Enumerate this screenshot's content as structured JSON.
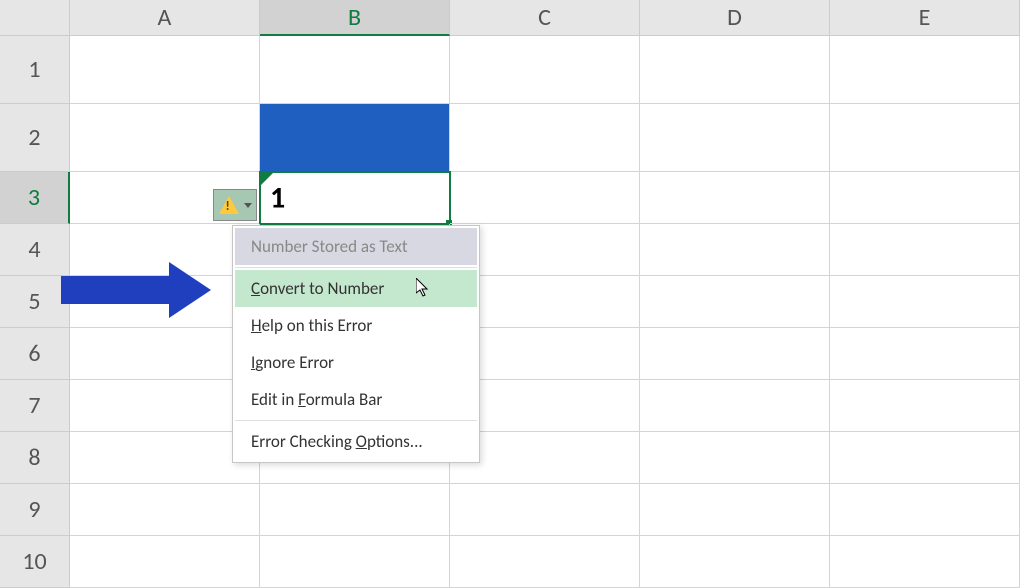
{
  "columns": [
    "A",
    "B",
    "C",
    "D",
    "E"
  ],
  "rows": [
    "1",
    "2",
    "3",
    "4",
    "5",
    "6",
    "7",
    "8",
    "9",
    "10"
  ],
  "selected_column_index": 1,
  "selected_row_index": 2,
  "cell_B3_value": "1",
  "error_menu": {
    "title": "Number Stored as Text",
    "items": [
      "Convert to Number",
      "Help on this Error",
      "Ignore Error",
      "Edit in Formula Bar",
      "Error Checking Options..."
    ],
    "hovered_index": 0
  },
  "colors": {
    "fill": "#1f5fbf",
    "arrow": "#1f3fbf",
    "excel_green": "#107c41"
  }
}
